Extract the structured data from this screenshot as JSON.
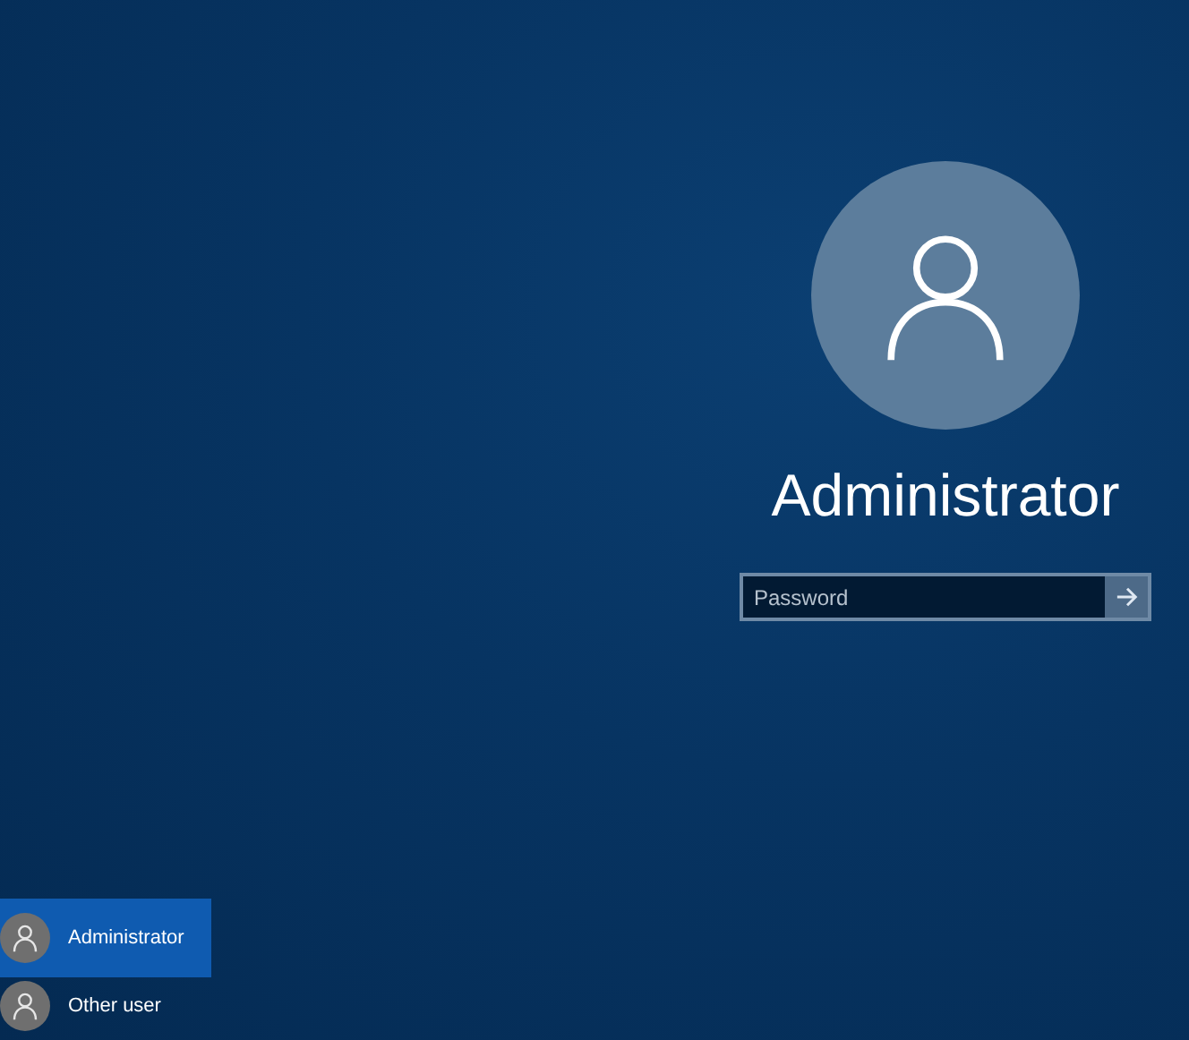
{
  "account": {
    "name": "Administrator"
  },
  "password": {
    "placeholder": "Password"
  },
  "users": [
    {
      "name": "Administrator",
      "selected": true
    },
    {
      "name": "Other user",
      "selected": false
    }
  ]
}
